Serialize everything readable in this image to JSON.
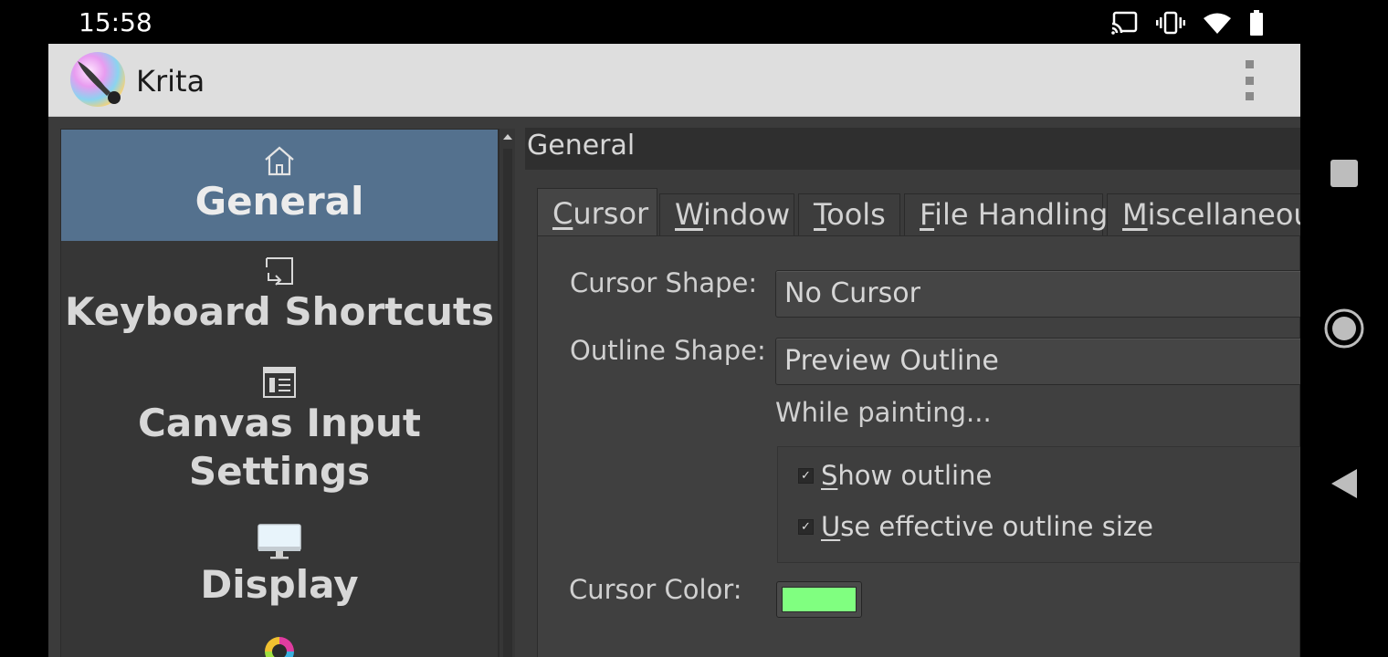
{
  "status_bar": {
    "time": "15:58"
  },
  "app": {
    "title": "Krita"
  },
  "sidebar": {
    "items": [
      {
        "label": "General",
        "icon": "home-icon",
        "active": true
      },
      {
        "label": "Keyboard Shortcuts",
        "icon": "shortcut-icon",
        "active": false
      },
      {
        "label_line1": "Canvas Input",
        "label_line2": "Settings",
        "icon": "canvas-input-icon",
        "active": false
      },
      {
        "label": "Display",
        "icon": "monitor-icon",
        "active": false
      },
      {
        "label": "",
        "icon": "color-wheel-icon",
        "active": false
      }
    ]
  },
  "panel": {
    "title": "General",
    "tabs": [
      {
        "first": "C",
        "rest": "ursor",
        "active": true
      },
      {
        "first": "W",
        "rest": "indow",
        "active": false
      },
      {
        "first": "T",
        "rest": "ools",
        "active": false
      },
      {
        "first": "F",
        "rest": "ile Handling",
        "active": false
      },
      {
        "first": "M",
        "rest": "iscellaneous",
        "active": false
      }
    ],
    "cursor": {
      "cursor_shape_label": "Cursor Shape:",
      "cursor_shape_value": "No Cursor",
      "outline_shape_label": "Outline Shape:",
      "outline_shape_value": "Preview Outline",
      "while_painting_label": "While painting...",
      "show_outline": {
        "first": "S",
        "rest": "how outline",
        "checked": true
      },
      "effective_outline": {
        "first": "U",
        "rest": "se effective outline size",
        "checked": true
      },
      "cursor_color_label": "Cursor Color:",
      "cursor_color": "#80ff80"
    }
  },
  "colors": {
    "sidebar_active": "#54718e",
    "titlebar": "#dedede",
    "background": "#404040"
  }
}
